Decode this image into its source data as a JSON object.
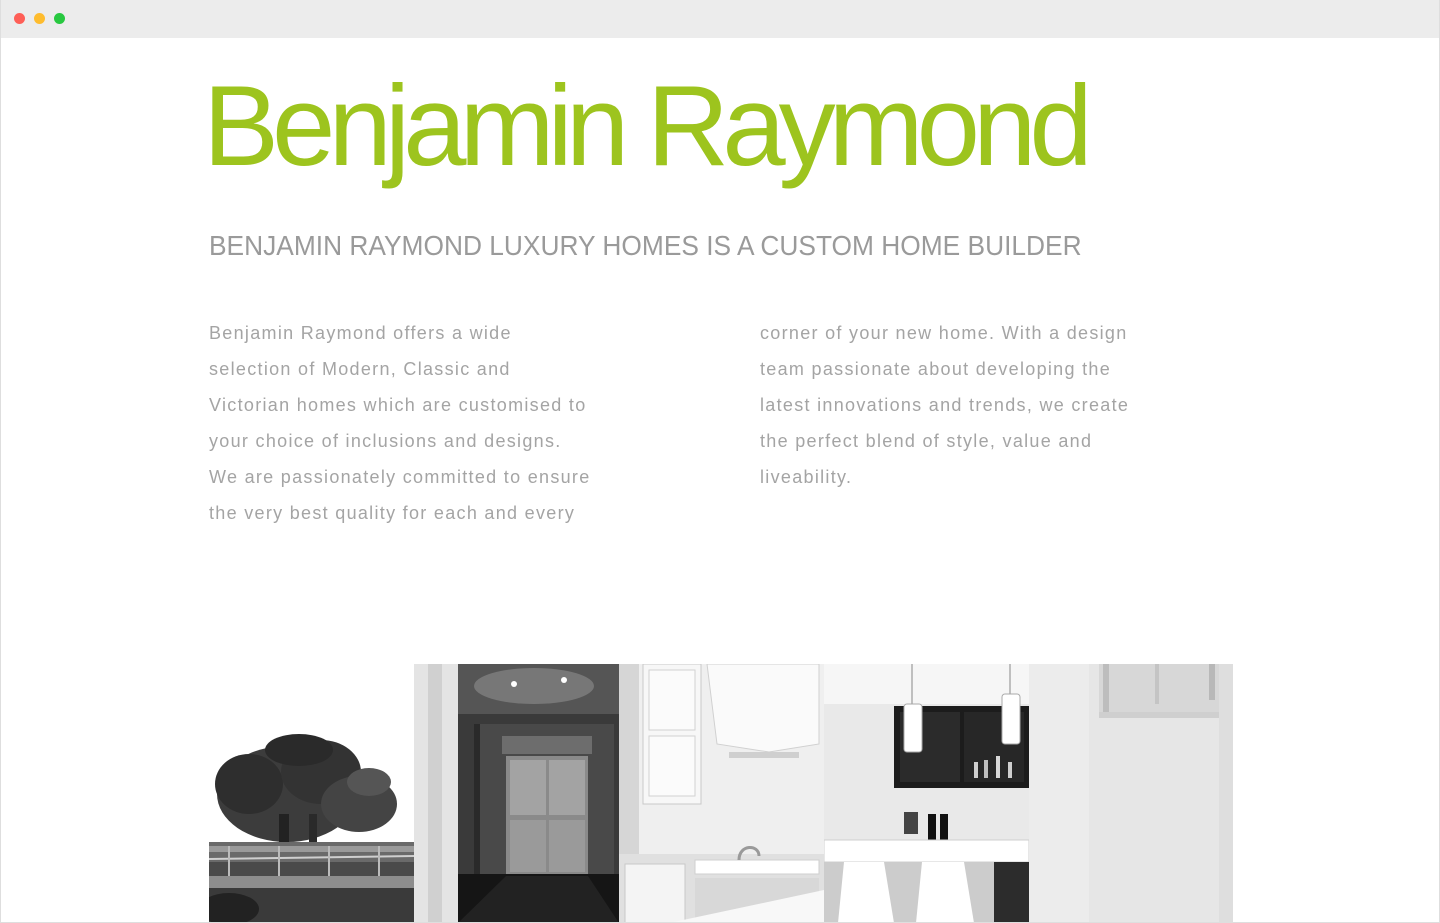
{
  "window": {
    "controls": [
      "close",
      "minimize",
      "zoom"
    ],
    "control_colors": {
      "close": "#fe5f57",
      "minimize": "#febc2e",
      "zoom": "#28c840"
    }
  },
  "header": {
    "brand_name": "Benjamin Raymond",
    "brand_color": "#9dc41e",
    "tagline": "BENJAMIN RAYMOND LUXURY HOMES IS A CUSTOM HOME BUILDER"
  },
  "intro": {
    "left_lines": [
      "Benjamin Raymond offers a wide",
      "selection of Modern, Classic and",
      "Victorian homes which are customised to",
      "your choice of inclusions and designs.",
      "We are passionately committed to ensure",
      "the very best quality for each and every"
    ],
    "right_lines": [
      "corner of your new home. With a design",
      "team passionate about developing the",
      "latest innovations and trends, we create",
      "the perfect blend of style, value and",
      "liveability."
    ]
  },
  "gallery": {
    "images": [
      {
        "icon": "tree-photo"
      },
      {
        "icon": "hallway-door-photo"
      },
      {
        "icon": "kitchen-photo"
      },
      {
        "icon": "kitchen-pendant-lights-photo"
      },
      {
        "icon": "interior-wall-photo"
      }
    ]
  }
}
